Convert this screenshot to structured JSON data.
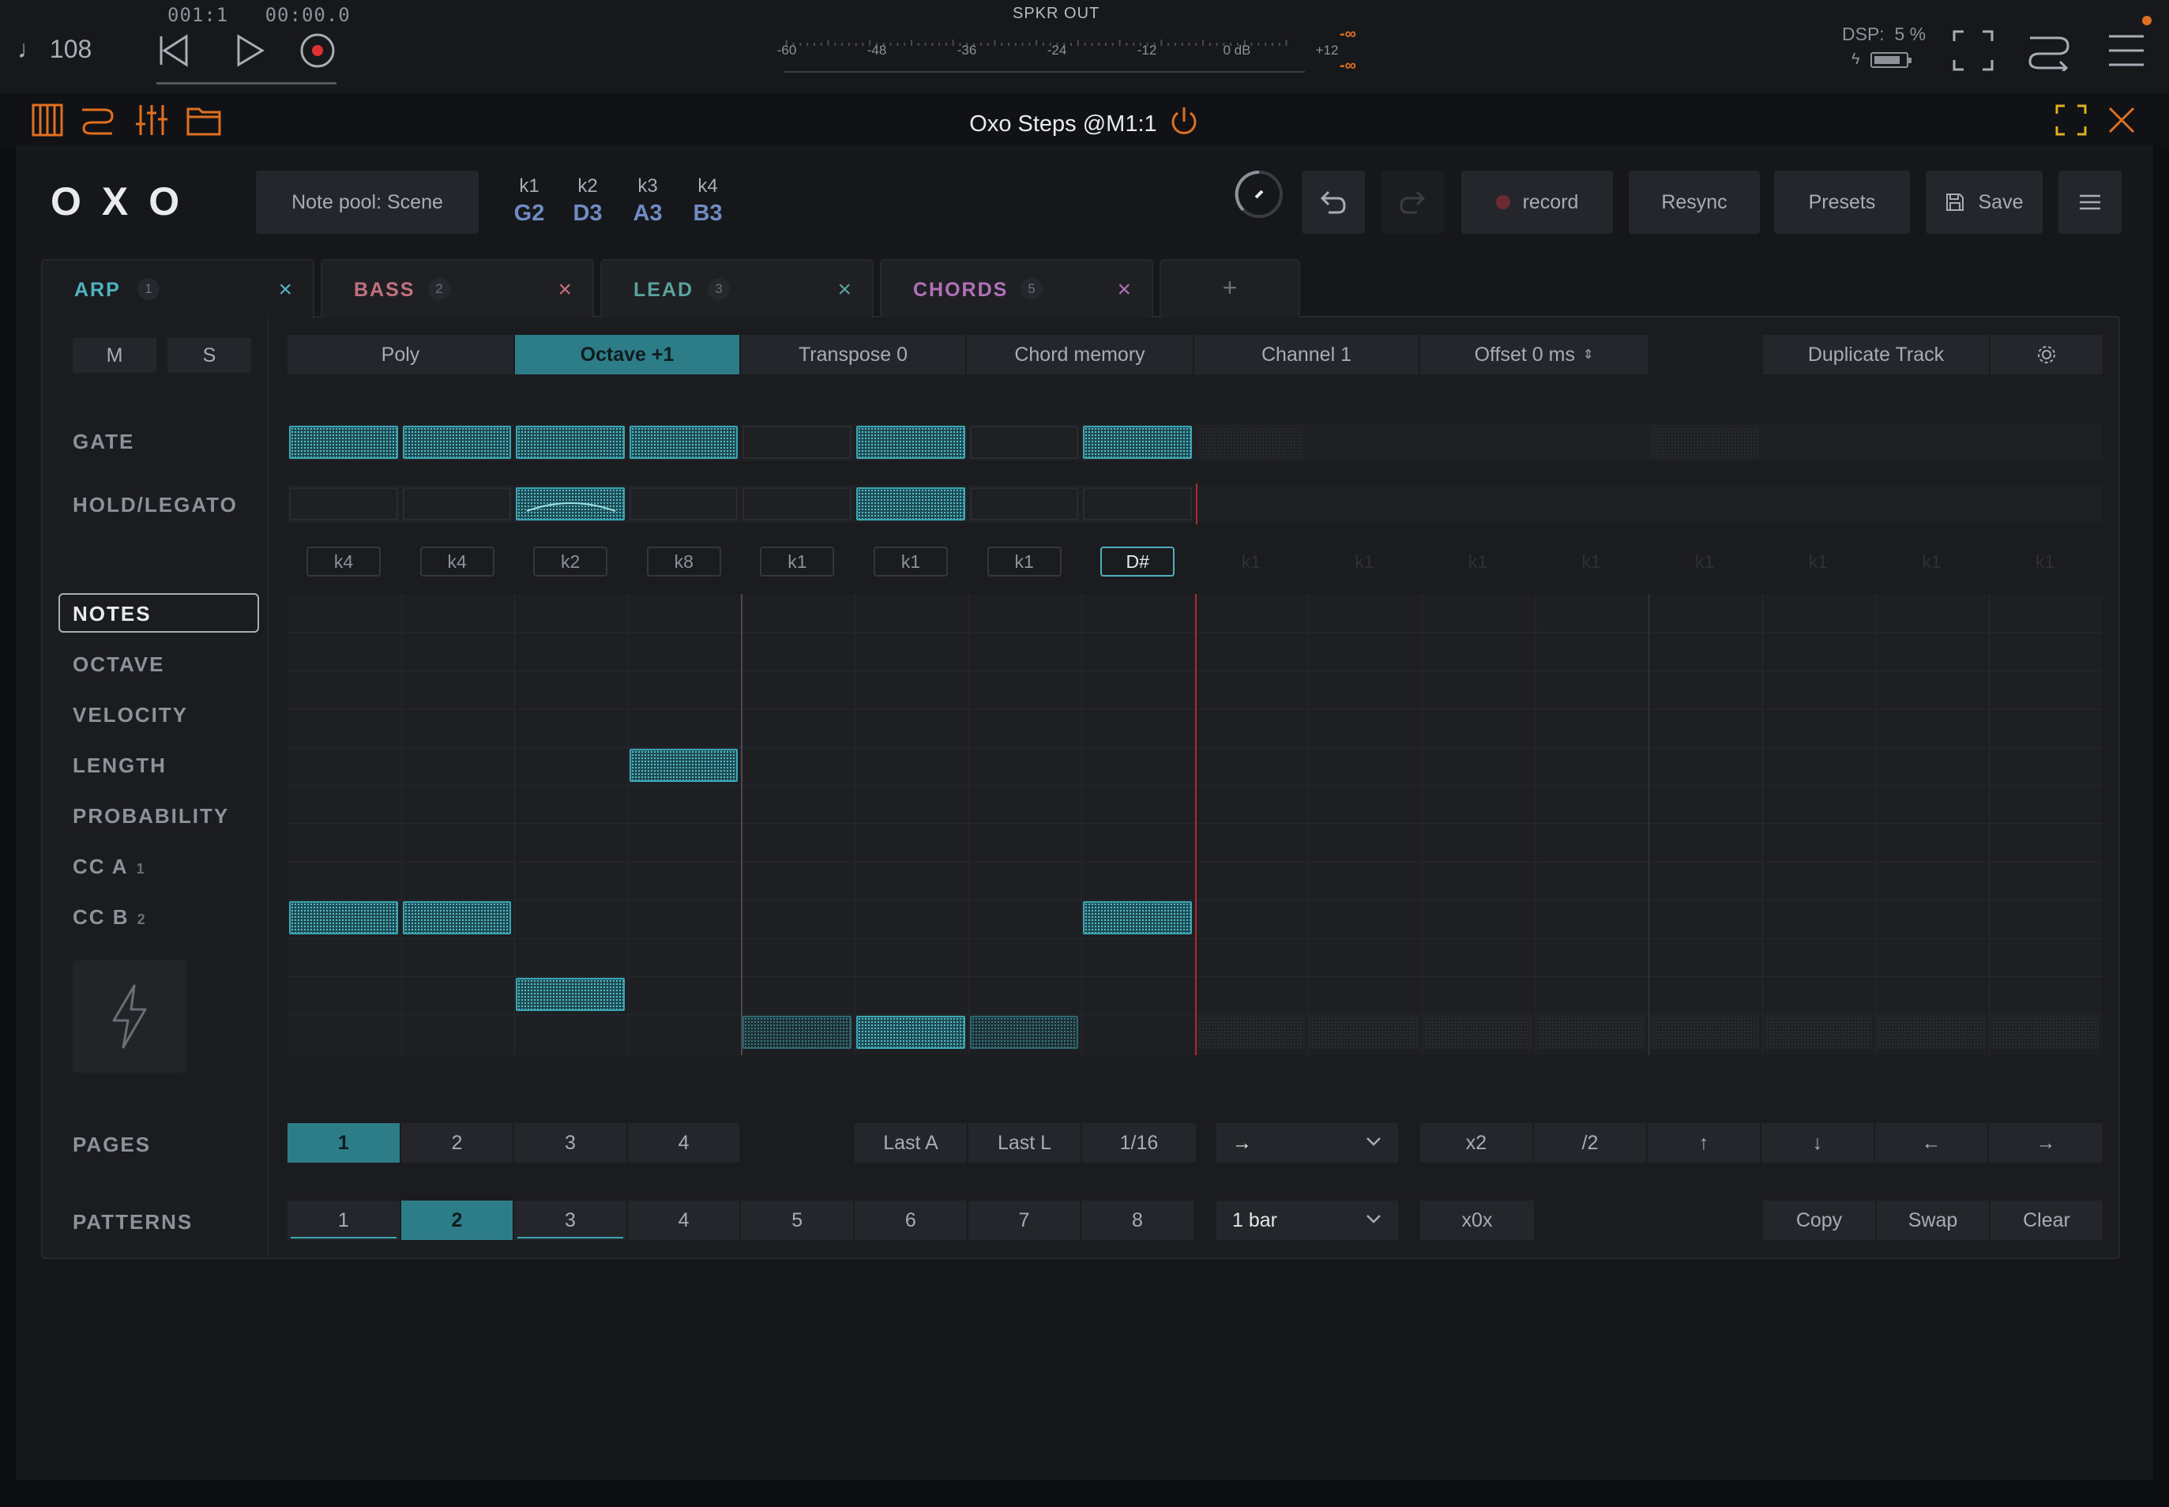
{
  "transport": {
    "tempo": "♩ 108",
    "position_bar": "001:1",
    "position_time": "00:00.0",
    "meter_title": "SPKR OUT",
    "meter_scale": [
      "-60",
      "-48",
      "-36",
      "-24",
      "-12",
      "0 dB",
      "+12"
    ],
    "meter_peak_left": "-∞",
    "meter_peak_right": "-∞",
    "dsp_label": "DSP:",
    "dsp_value": "5 %",
    "battery_level": 0.8
  },
  "plugin": {
    "title": "Oxo Steps @M1:1"
  },
  "header": {
    "logo": "OXO",
    "note_pool": "Note pool: Scene",
    "knobs": [
      {
        "label": "k1",
        "note": "G2"
      },
      {
        "label": "k2",
        "note": "D3"
      },
      {
        "label": "k3",
        "note": "A3"
      },
      {
        "label": "k4",
        "note": "B3"
      }
    ],
    "record_label": "record",
    "resync_label": "Resync",
    "presets_label": "Presets",
    "save_label": "Save"
  },
  "tabs": [
    {
      "name": "ARP",
      "num": "1",
      "color": "#4fb3c2"
    },
    {
      "name": "BASS",
      "num": "2",
      "color": "#c4707f"
    },
    {
      "name": "LEAD",
      "num": "3",
      "color": "#5aa39d"
    },
    {
      "name": "CHORDS",
      "num": "5",
      "color": "#b271b8"
    }
  ],
  "add_tab": "+",
  "mute_label": "M",
  "solo_label": "S",
  "options": {
    "poly": "Poly",
    "octave": "Octave +1",
    "transpose": "Transpose 0",
    "chord_memory": "Chord memory",
    "channel": "Channel 1",
    "offset": "Offset 0 ms",
    "duplicate": "Duplicate Track"
  },
  "lanes": {
    "gate": "GATE",
    "hold": "HOLD/LEGATO",
    "notes": "NOTES",
    "octave": "OCTAVE",
    "velocity": "VELOCITY",
    "length": "LENGTH",
    "probability": "PROBABILITY",
    "cc_a": "CC A",
    "cc_a_num": "1",
    "cc_b": "CC B",
    "cc_b_num": "2"
  },
  "step_notes": [
    "k4",
    "k4",
    "k2",
    "k8",
    "k1",
    "k1",
    "k1",
    "D#",
    "k1",
    "k1",
    "k1",
    "k1",
    "k1",
    "k1",
    "k1",
    "k1"
  ],
  "pages": {
    "label": "PAGES",
    "items": [
      "1",
      "2",
      "3",
      "4"
    ],
    "last_a": "Last A",
    "last_l": "Last L",
    "division": "1/16",
    "direction": "→",
    "x2": "x2",
    "half": "/2",
    "up": "↑",
    "down": "↓",
    "left": "←",
    "right": "→"
  },
  "patterns": {
    "label": "PATTERNS",
    "items": [
      "1",
      "2",
      "3",
      "4",
      "5",
      "6",
      "7",
      "8"
    ],
    "length": "1 bar",
    "x0x": "x0x",
    "copy": "Copy",
    "swap": "Swap",
    "clear": "Clear"
  }
}
